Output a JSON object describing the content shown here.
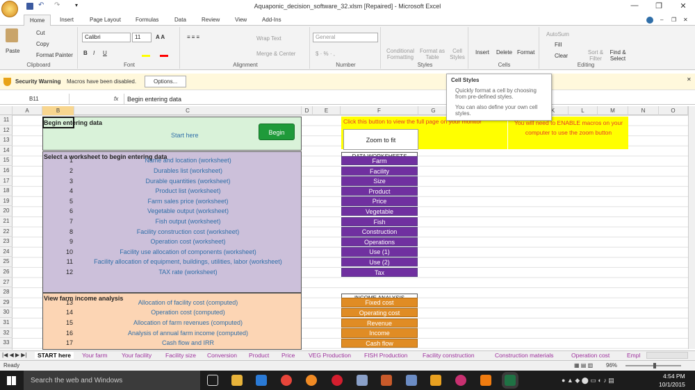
{
  "window": {
    "title": "Aquaponic_decision_software_32.xlsm [Repaired] - Microsoft Excel",
    "qat": "▾"
  },
  "ribbon": {
    "tabs": [
      "Home",
      "Insert",
      "Page Layout",
      "Formulas",
      "Data",
      "Review",
      "View",
      "Add-Ins"
    ],
    "clipboard": {
      "label": "Clipboard",
      "paste": "Paste",
      "cut": "Cut",
      "copy": "Copy",
      "format_painter": "Format Painter"
    },
    "font": {
      "label": "Font",
      "name": "Calibri",
      "size": "11"
    },
    "alignment": {
      "label": "Alignment",
      "wrap": "Wrap Text",
      "merge": "Merge & Center"
    },
    "number": {
      "label": "Number",
      "format": "General"
    },
    "styles": {
      "label": "Styles",
      "conditional": "Conditional Formatting",
      "format_table": "Format as Table",
      "cell_styles": "Cell Styles"
    },
    "cells": {
      "label": "Cells",
      "insert": "Insert",
      "delete": "Delete",
      "format": "Format"
    },
    "editing": {
      "label": "Editing",
      "autosum": "AutoSum",
      "fill": "Fill",
      "clear": "Clear",
      "sort": "Sort & Filter",
      "find": "Find & Select"
    }
  },
  "tooltip": {
    "title": "Cell Styles",
    "line1": "Quickly format a cell by choosing",
    "line2": "from pre-defined styles.",
    "line3": "You can also define your own cell",
    "line4": "styles."
  },
  "security": {
    "label": "Security Warning",
    "message": "Macros have been disabled.",
    "button": "Options..."
  },
  "formula": {
    "name_box": "B11",
    "fx": "fx",
    "value": "Begin entering data"
  },
  "columns": [
    "A",
    "B",
    "C",
    "D",
    "E",
    "F",
    "G",
    "H",
    "I",
    "J",
    "K",
    "L",
    "M",
    "N",
    "O"
  ],
  "rows": [
    "11",
    "12",
    "13",
    "14",
    "15",
    "16",
    "17",
    "18",
    "19",
    "20",
    "21",
    "22",
    "23",
    "24",
    "25",
    "26",
    "27",
    "28",
    "29",
    "30",
    "31",
    "32",
    "33"
  ],
  "sheet": {
    "begin_title": "Begin entering data",
    "start_here": "Start here",
    "begin_btn": "Begin",
    "select_title": "Select a worksheet to begin entering data",
    "worksheets": [
      [
        "1",
        "Name and location (worksheet)"
      ],
      [
        "2",
        "Durables list (worksheet)"
      ],
      [
        "3",
        "Durable quantities (worksheet)"
      ],
      [
        "4",
        "Product list (worksheet)"
      ],
      [
        "5",
        "Farm sales price (worksheet)"
      ],
      [
        "6",
        "Vegetable output (worksheet)"
      ],
      [
        "7",
        "Fish output (worksheet)"
      ],
      [
        "8",
        "Facility construction cost (worksheet)"
      ],
      [
        "9",
        "Operation cost (worksheet)"
      ],
      [
        "10",
        "Facility use allocation of components (worksheet)"
      ],
      [
        "11",
        "Facility allocation of equipment, buildings, utilities, labor (worksheet)"
      ],
      [
        "12",
        "TAX rate (worksheet)"
      ]
    ],
    "income_title": "View farm income analysis",
    "income": [
      [
        "13",
        "Allocation of facility cost (computed)"
      ],
      [
        "14",
        "Operation cost (computed)"
      ],
      [
        "15",
        "Allocation of farm revenues (computed)"
      ],
      [
        "16",
        "Analysis of annual farm income (computed)"
      ],
      [
        "17",
        "Cash flow and IRR"
      ]
    ],
    "zoom_note": "Click this button to view the full page on your monitor",
    "macro_note": "You will need to ENABLE macros on your computer to use the zoom button",
    "zoom_btn": "Zoom to fit",
    "data_ws_title": "DATA WORKSHEETS",
    "data_ws": [
      "Farm",
      "Facility",
      "Size",
      "Product",
      "Price",
      "Vegetable",
      "Fish",
      "Construction",
      "Operations",
      "Use (1)",
      "Use (2)",
      "Tax"
    ],
    "income_title2": "INCOME ANALYSIS",
    "income_btns": [
      "Fixed cost",
      "Operating cost",
      "Revenue",
      "Income",
      "Cash flow"
    ]
  },
  "sheet_tabs": [
    "START here",
    "Your farm",
    "Your facility",
    "Facility size",
    "Conversion",
    "Product",
    "Price",
    "VEG Production",
    "FISH Production",
    "Facility construction",
    "Construction materials",
    "Operation cost",
    "Empl"
  ],
  "status": {
    "ready": "Ready",
    "zoom": "96%"
  },
  "taskbar": {
    "search": "Search the web and Windows",
    "time": "4:54 PM",
    "date": "10/1/2015"
  },
  "colors": {
    "green": "#d9f2d9",
    "purple": "#ccc0da",
    "orange": "#fcd5b4",
    "yellow": "#ffff00",
    "btn_purple": "#7030a0",
    "btn_orange": "#e08c24"
  }
}
